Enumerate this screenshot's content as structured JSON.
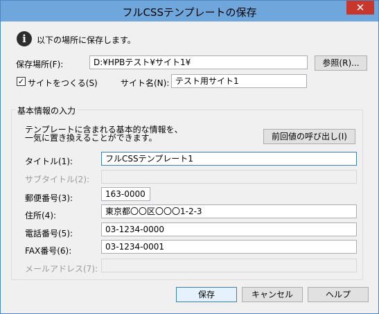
{
  "window": {
    "title": "フルCSSテンプレートの保存",
    "close_glyph": "✕"
  },
  "info": {
    "icon_glyph": "i",
    "message": "以下の場所に保存します。"
  },
  "location": {
    "label": "保存場所(F):",
    "value": "D:¥HPBテスト¥サイト1¥",
    "browse_label": "参照(R)..."
  },
  "site": {
    "create_checkbox_label": "サイトをつくる(S)",
    "create_checked": true,
    "check_glyph": "✓",
    "name_label": "サイト名(N):",
    "name_value": "テスト用サイト1"
  },
  "basic_info": {
    "group_label": "基本情報の入力",
    "description_line1": "テンプレートに含まれる基本的な情報を、",
    "description_line2": "一気に置き換えることができます。",
    "recall_button": "前回値の呼び出し(I)",
    "fields": {
      "title": {
        "label": "タイトル(1):",
        "value": "フルCSSテンプレート1"
      },
      "subtitle": {
        "label": "サブタイトル(2):",
        "value": ""
      },
      "postal": {
        "label": "郵便番号(3):",
        "value": "163-0000"
      },
      "address": {
        "label": "住所(4):",
        "value": "東京都〇〇区〇〇〇1-2-3"
      },
      "phone": {
        "label": "電話番号(5):",
        "value": "03-1234-0000"
      },
      "fax": {
        "label": "FAX番号(6):",
        "value": "03-1234-0001"
      },
      "email": {
        "label": "メールアドレス(7):",
        "value": ""
      }
    }
  },
  "footer": {
    "save": "保存",
    "cancel": "キャンセル",
    "help": "ヘルプ"
  }
}
